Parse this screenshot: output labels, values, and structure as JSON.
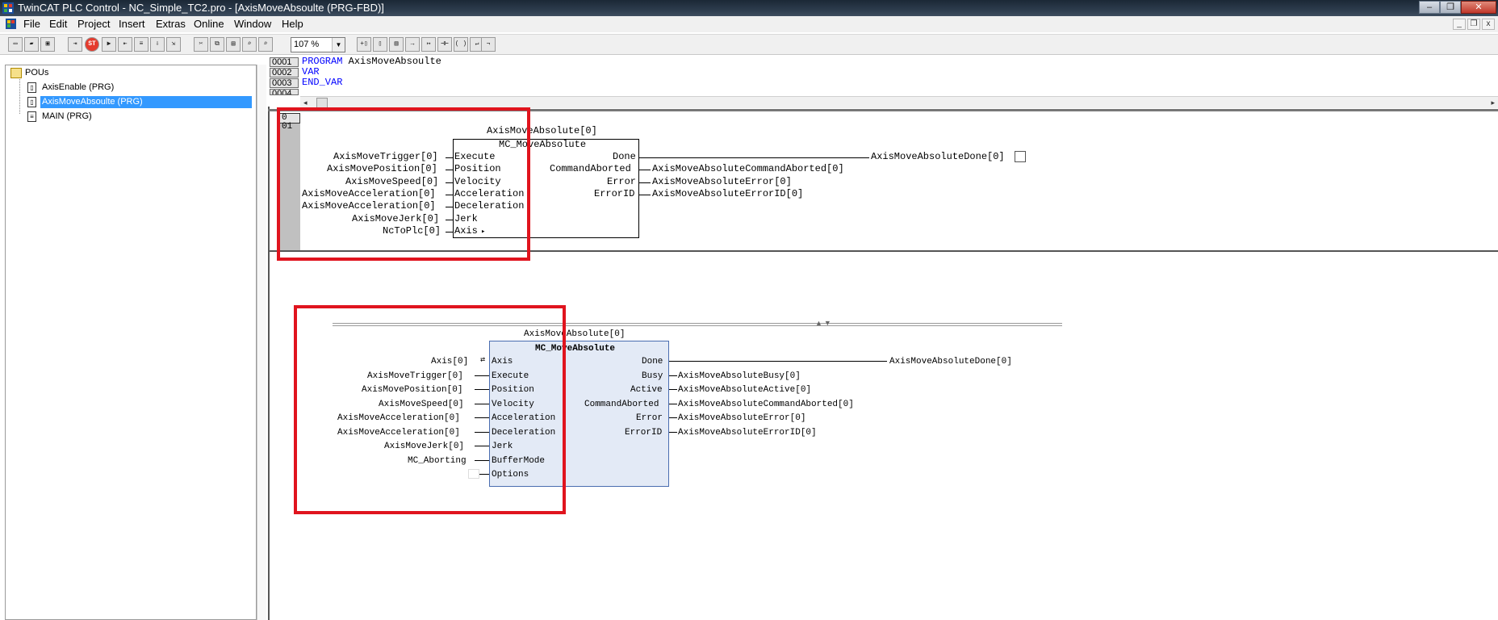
{
  "window": {
    "title": "TwinCAT PLC Control - NC_Simple_TC2.pro - [AxisMoveAbsoulte (PRG-FBD)]",
    "min_label": "–",
    "max_label": "❐",
    "close_label": "✕"
  },
  "menu": {
    "items": [
      "File",
      "Edit",
      "Project",
      "Insert",
      "Extras",
      "Online",
      "Window",
      "Help"
    ],
    "mdi_min": "_",
    "mdi_restore": "❐",
    "mdi_close": "x"
  },
  "toolbar": {
    "zoom_value": "107 %",
    "dropdown_arrow": "▼"
  },
  "tree": {
    "root": "POUs",
    "items": [
      {
        "label": "AxisEnable (PRG)",
        "selected": false
      },
      {
        "label": "AxisMoveAbsoulte (PRG)",
        "selected": true
      },
      {
        "label": "MAIN (PRG)",
        "selected": false
      }
    ]
  },
  "declaration": {
    "lines": [
      {
        "num": "0001",
        "kw": "PROGRAM",
        "text": " AxisMoveAbsoulte"
      },
      {
        "num": "0002",
        "kw": "VAR",
        "text": ""
      },
      {
        "num": "0003",
        "kw": "END_VAR",
        "text": ""
      },
      {
        "num": "0004",
        "kw": "",
        "text": ""
      }
    ]
  },
  "network1": {
    "number": "0 01",
    "instance": "AxisMoveAbsolute[0]",
    "fb_type": "MC_MoveAbsolute",
    "inputs": [
      {
        "var": "AxisMoveTrigger[0]",
        "pin": "Execute"
      },
      {
        "var": "AxisMovePosition[0]",
        "pin": "Position"
      },
      {
        "var": "AxisMoveSpeed[0]",
        "pin": "Velocity"
      },
      {
        "var": "AxisMoveAcceleration[0]",
        "pin": "Acceleration"
      },
      {
        "var": "AxisMoveAcceleration[0]",
        "pin": "Deceleration"
      },
      {
        "var": "AxisMoveJerk[0]",
        "pin": "Jerk"
      },
      {
        "var": "NcToPlc[0]",
        "pin": "Axis"
      }
    ],
    "outputs": [
      {
        "pin": "Done",
        "var": "AxisMoveAbsoluteDone[0]"
      },
      {
        "pin": "CommandAborted",
        "var": "AxisMoveAbsoluteCommandAborted[0]"
      },
      {
        "pin": "Error",
        "var": "AxisMoveAbsoluteError[0]"
      },
      {
        "pin": "ErrorID",
        "var": "AxisMoveAbsoluteErrorID[0]"
      }
    ]
  },
  "diagram2": {
    "instance": "AxisMoveAbsolute[0]",
    "fb_type": "MC_MoveAbsolute",
    "inputs": [
      {
        "var": "Axis[0]",
        "pin": "Axis"
      },
      {
        "var": "AxisMoveTrigger[0]",
        "pin": "Execute"
      },
      {
        "var": "AxisMovePosition[0]",
        "pin": "Position"
      },
      {
        "var": "AxisMoveSpeed[0]",
        "pin": "Velocity"
      },
      {
        "var": "AxisMoveAcceleration[0]",
        "pin": "Acceleration"
      },
      {
        "var": "AxisMoveAcceleration[0]",
        "pin": "Deceleration"
      },
      {
        "var": "AxisMoveJerk[0]",
        "pin": "Jerk"
      },
      {
        "var": "MC_Aborting",
        "pin": "BufferMode"
      },
      {
        "var": "",
        "pin": "Options"
      }
    ],
    "outputs": [
      {
        "pin": "Done",
        "var": "AxisMoveAbsoluteDone[0]"
      },
      {
        "pin": "Busy",
        "var": "AxisMoveAbsoluteBusy[0]"
      },
      {
        "pin": "Active",
        "var": "AxisMoveAbsoluteActive[0]"
      },
      {
        "pin": "CommandAborted",
        "var": "AxisMoveAbsoluteCommandAborted[0]"
      },
      {
        "pin": "Error",
        "var": "AxisMoveAbsoluteError[0]"
      },
      {
        "pin": "ErrorID",
        "var": "AxisMoveAbsoluteErrorID[0]"
      }
    ]
  },
  "colors": {
    "highlight": "#e0141e",
    "selection": "#3399ff",
    "keyword": "#0000ff",
    "block2_fill": "#e3eaf6"
  }
}
